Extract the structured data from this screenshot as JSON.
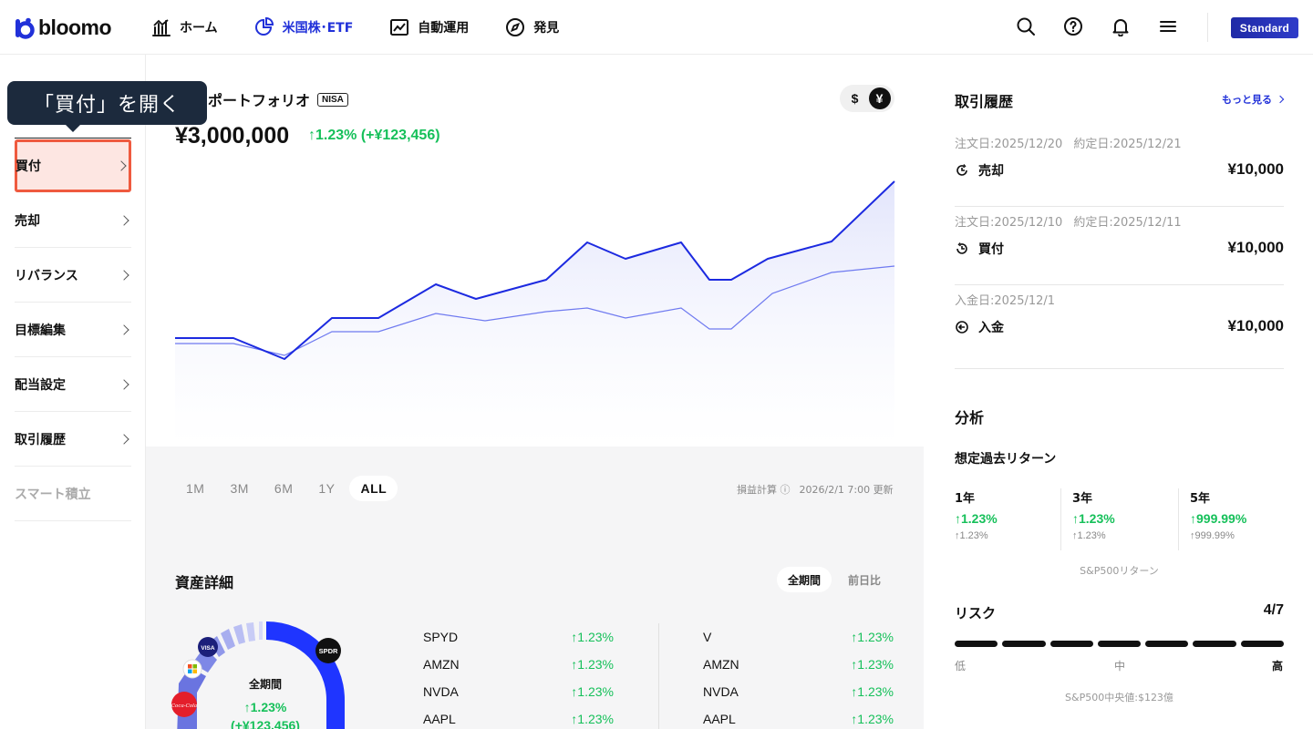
{
  "brand": {
    "name": "bloomo",
    "accent": "#2131d9",
    "positive": "#16c05a",
    "highlight_border": "#ef5a3f"
  },
  "header": {
    "nav": [
      {
        "label": "ホーム",
        "icon": "home-chart-icon"
      },
      {
        "label": "米国株･ETF",
        "icon": "pie-chart-icon"
      },
      {
        "label": "自動運用",
        "icon": "trend-chart-icon"
      },
      {
        "label": "発見",
        "icon": "compass-icon"
      }
    ],
    "plan": "Standard"
  },
  "sidebar": {
    "tooltip": "「買付」を開く",
    "items": [
      {
        "label": "買付"
      },
      {
        "label": "売却"
      },
      {
        "label": "リバランス"
      },
      {
        "label": "目標編集"
      },
      {
        "label": "配当設定"
      },
      {
        "label": "取引履歴"
      },
      {
        "label": "スマート積立"
      }
    ]
  },
  "portfolio": {
    "title": "ポートフォリオ",
    "badge": "NISA",
    "amount": "¥3,000,000",
    "change": "↑1.23% (+¥123,456)",
    "currency": {
      "usd": "$",
      "jpy": "¥",
      "selected": "jpy"
    },
    "ranges": [
      "1M",
      "3M",
      "6M",
      "1Y",
      "ALL"
    ],
    "selected_range": "ALL",
    "calc_label": "損益計算 ⓘ",
    "updated": "2026/2/1 7:00",
    "updated_suffix": "更新"
  },
  "assets": {
    "title": "資産詳細",
    "tabs": [
      "全期間",
      "前日比"
    ],
    "donut_label": "全期間",
    "donut_change": "↑1.23%",
    "donut_change_amount": "(+¥123,456)",
    "left": [
      {
        "ticker": "SPYD",
        "change": "↑1.23%"
      },
      {
        "ticker": "AMZN",
        "change": "↑1.23%"
      },
      {
        "ticker": "NVDA",
        "change": "↑1.23%"
      },
      {
        "ticker": "AAPL",
        "change": "↑1.23%"
      }
    ],
    "right": [
      {
        "ticker": "V",
        "change": "↑1.23%"
      },
      {
        "ticker": "AMZN",
        "change": "↑1.23%"
      },
      {
        "ticker": "NVDA",
        "change": "↑1.23%"
      },
      {
        "ticker": "AAPL",
        "change": "↑1.23%"
      }
    ],
    "logos": {
      "spdr": "SPDR",
      "visa": "VISA",
      "coke": "Coca-Cola"
    }
  },
  "history": {
    "title": "取引履歴",
    "more": "もっと見る",
    "items": [
      {
        "date1": "注文日:2025/12/20",
        "date2": "約定日:2025/12/21",
        "type": "売却",
        "amount": "¥10,000",
        "icon": "sell-icon"
      },
      {
        "date1": "注文日:2025/12/10",
        "date2": "約定日:2025/12/11",
        "type": "買付",
        "amount": "¥10,000",
        "icon": "buy-icon"
      },
      {
        "date1": "入金日:2025/12/1",
        "date2": "",
        "type": "入金",
        "amount": "¥10,000",
        "icon": "deposit-icon"
      }
    ]
  },
  "analysis": {
    "title": "分析",
    "subtitle": "想定過去リターン",
    "returns": [
      {
        "year": "1年",
        "value": "↑1.23%",
        "bench": "↑1.23%"
      },
      {
        "year": "3年",
        "value": "↑1.23%",
        "bench": "↑1.23%"
      },
      {
        "year": "5年",
        "value": "↑999.99%",
        "bench": "↑999.99%"
      }
    ],
    "bench_label": "S&P500リターン",
    "risk_label": "リスク",
    "risk_value": "4/7",
    "risk_level": 4,
    "risk_max": 7,
    "risk_low": "低",
    "risk_mid": "中",
    "risk_high": "高",
    "median_note": "S&P500中央値:$123億"
  }
}
